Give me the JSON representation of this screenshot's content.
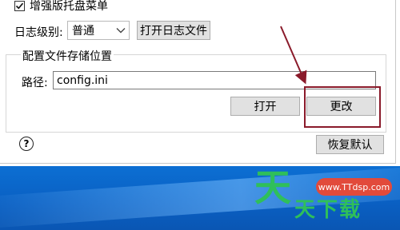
{
  "dialog": {
    "tray_menu_checkbox_label": "增强版托盘菜单",
    "tray_menu_checked": true,
    "log_level_label": "日志级别:",
    "log_level_value": "普通",
    "open_log_button": "打开日志文件",
    "config_group_title": "配置文件存储位置",
    "path_label": "路径:",
    "path_value": "config.ini",
    "open_button": "打开",
    "change_button": "更改",
    "help_icon_text": "?",
    "restore_default_button": "恢复默认"
  },
  "watermark": {
    "logo_char": "天",
    "bubble_text": "www.TTdsp.com",
    "text": "天下载"
  },
  "colors": {
    "annotation_red": "#8a1a2a",
    "desktop_blue": "#0c6fd3"
  }
}
